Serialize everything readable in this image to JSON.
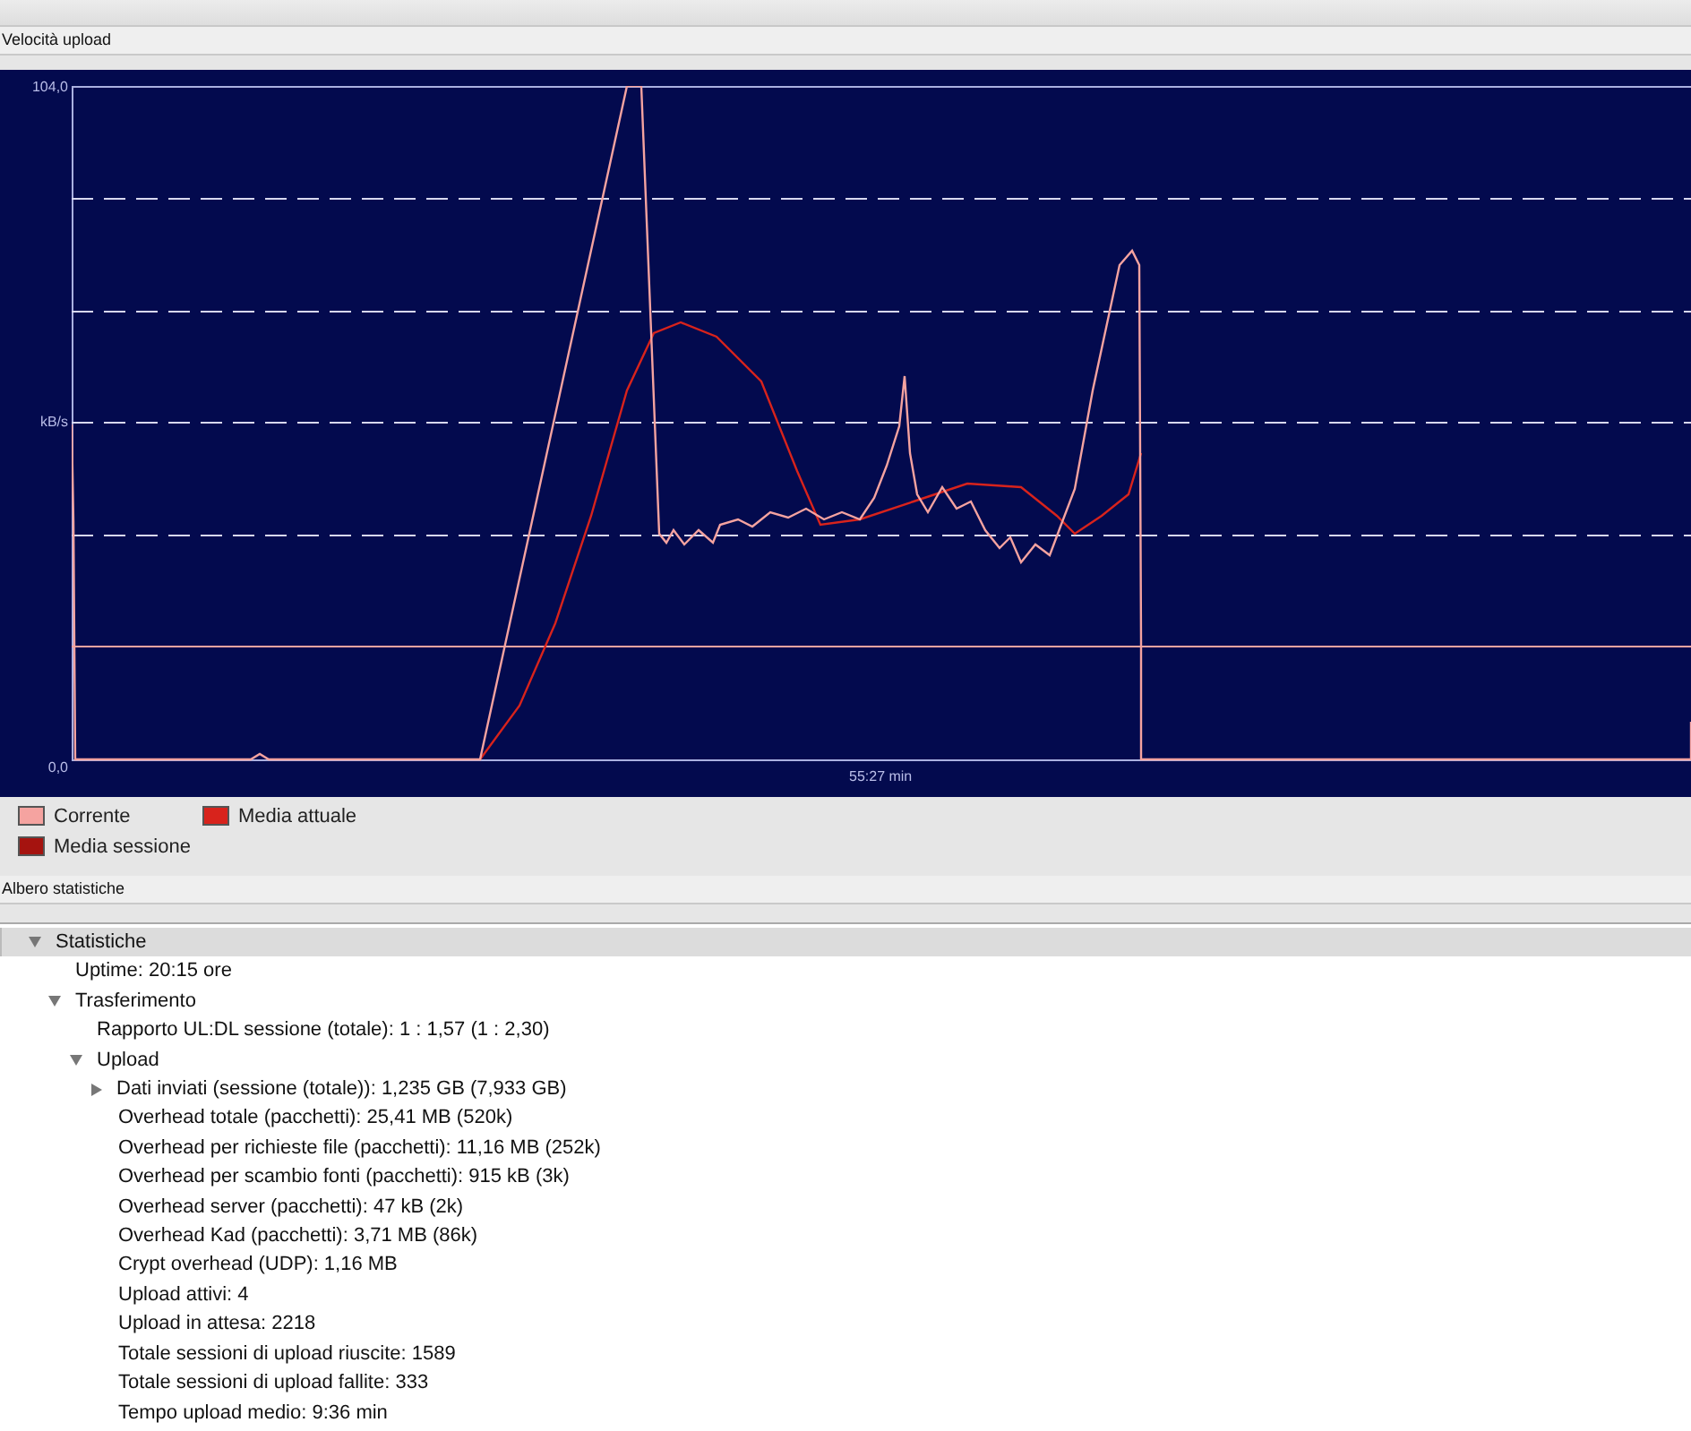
{
  "graph_section": {
    "title": "Velocità upload"
  },
  "graph": {
    "y_max_label": "104,0",
    "y_unit_label": "kB/s",
    "y_min_label": "0,0",
    "x_label": "55:27 min"
  },
  "legend": [
    {
      "label": "Corrente",
      "color": "#f5a3a0"
    },
    {
      "label": "Media attuale",
      "color": "#d8231c"
    },
    {
      "label": "Media sessione",
      "color": "#a5130f"
    }
  ],
  "tree_section": {
    "title": "Albero statistiche"
  },
  "tree": [
    {
      "label": "Statistiche",
      "expanded": true,
      "children": [
        {
          "label": "Uptime: 20:15 ore"
        },
        {
          "label": "Trasferimento",
          "expanded": true,
          "children": [
            {
              "label": "Rapporto UL:DL sessione (totale): 1 : 1,57 (1 : 2,30)"
            },
            {
              "label": "Upload",
              "expanded": true,
              "children": [
                {
                  "label": "Dati inviati (sessione (totale)): 1,235 GB (7,933 GB)",
                  "expanded": false
                },
                {
                  "label": "Overhead totale (pacchetti): 25,41 MB (520k)"
                },
                {
                  "label": "Overhead per richieste file (pacchetti): 11,16 MB (252k)"
                },
                {
                  "label": "Overhead per scambio fonti (pacchetti): 915 kB (3k)"
                },
                {
                  "label": "Overhead server (pacchetti): 47 kB (2k)"
                },
                {
                  "label": "Overhead Kad (pacchetti): 3,71 MB (86k)"
                },
                {
                  "label": "Crypt overhead (UDP): 1,16 MB"
                },
                {
                  "label": "Upload attivi: 4"
                },
                {
                  "label": "Upload in attesa: 2218"
                },
                {
                  "label": "Totale sessioni di upload riuscite: 1589"
                },
                {
                  "label": "Totale sessioni di upload fallite: 333"
                },
                {
                  "label": "Tempo upload medio: 9:36 min"
                }
              ]
            }
          ]
        }
      ]
    }
  ]
}
